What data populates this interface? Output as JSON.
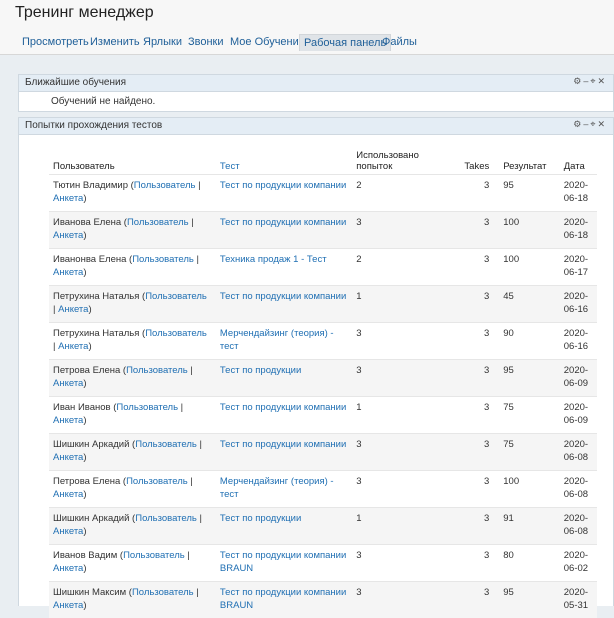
{
  "app": {
    "title": "Тренинг менеджер"
  },
  "tabs": [
    {
      "label": "Просмотреть"
    },
    {
      "label": "Изменить"
    },
    {
      "label": "Ярлыки"
    },
    {
      "label": "Звонки"
    },
    {
      "label": "Мое Обучение"
    },
    {
      "label": "Рабочая панель",
      "active": true
    },
    {
      "label": "Файлы"
    }
  ],
  "upcoming": {
    "title": "Ближайшие обучения",
    "empty": "Обучений не найдено."
  },
  "attempts": {
    "title": "Попытки прохождения тестов",
    "columns": {
      "user": "Пользователь",
      "test": "Тест",
      "used": "Использовано попыток",
      "takes": "Takes",
      "result": "Результат",
      "date": "Дата"
    },
    "rows": [
      {
        "name": "Тютин Владимир",
        "test": "Тест по продукции компании",
        "used": "2",
        "takes": "3",
        "result": "95",
        "date": "2020-06-18"
      },
      {
        "name": "Иванова Елена",
        "test": "Тест по продукции компании",
        "used": "3",
        "takes": "3",
        "result": "100",
        "date": "2020-06-18"
      },
      {
        "name": "Иванонва Елена",
        "test": "Техника продаж 1 - Тест",
        "used": "2",
        "takes": "3",
        "result": "100",
        "date": "2020-06-17"
      },
      {
        "name": "Петрухина Наталья",
        "test": "Тест по продукции компании",
        "used": "1",
        "takes": "3",
        "result": "45",
        "date": "2020-06-16"
      },
      {
        "name": "Петрухина Наталья",
        "test": "Мерчендайзинг (теория) - тест",
        "used": "3",
        "takes": "3",
        "result": "90",
        "date": "2020-06-16"
      },
      {
        "name": "Петрова Елена",
        "test": "Тест по продукции",
        "used": "3",
        "takes": "3",
        "result": "95",
        "date": "2020-06-09"
      },
      {
        "name": "Иван Иванов",
        "test": "Тест по продукции компании",
        "used": "1",
        "takes": "3",
        "result": "75",
        "date": "2020-06-09"
      },
      {
        "name": "Шишкин Аркадий",
        "test": "Тест по продукции компании",
        "used": "3",
        "takes": "3",
        "result": "75",
        "date": "2020-06-08"
      },
      {
        "name": "Петрова Елена",
        "test": "Мерчендайзинг (теория) - тест",
        "used": "3",
        "takes": "3",
        "result": "100",
        "date": "2020-06-08"
      },
      {
        "name": "Шишкин Аркадий",
        "test": "Тест по продукции",
        "used": "1",
        "takes": "3",
        "result": "91",
        "date": "2020-06-08"
      },
      {
        "name": "Иванов Вадим",
        "test": "Тест по продукции компании BRAUN",
        "used": "3",
        "takes": "3",
        "result": "80",
        "date": "2020-06-02"
      },
      {
        "name": "Шишкин Максим",
        "test": "Тест по продукции компании BRAUN",
        "used": "3",
        "takes": "3",
        "result": "95",
        "date": "2020-05-31"
      }
    ],
    "user_link": "Пользователь",
    "profile_link": "Анкета"
  },
  "icons": {
    "panel_controls": [
      "settings-icon",
      "minimize-icon",
      "expand-icon",
      "close-icon"
    ]
  },
  "colors": {
    "link": "#1f6fb3",
    "panel_header": "#e4edf5"
  }
}
